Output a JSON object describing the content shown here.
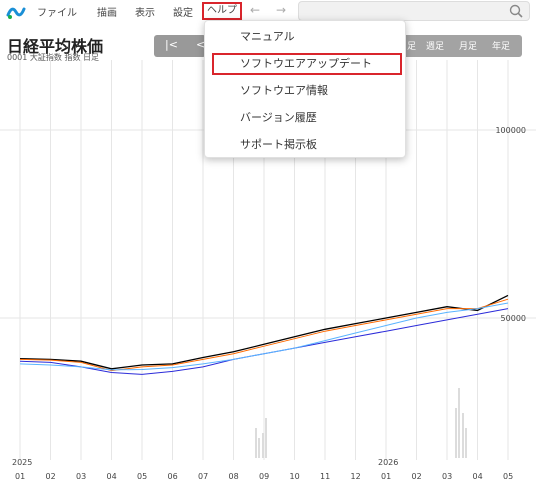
{
  "menu": {
    "items": [
      "ファイル",
      "描画",
      "表示",
      "設定"
    ],
    "help_label": "ヘルプ"
  },
  "header": {
    "title": "日経平均株価",
    "subtitle": "0001 大証指数 指数 日足"
  },
  "chart_controls": {
    "first": "|<",
    "prev": "<"
  },
  "periods": [
    "足",
    "週足",
    "月足",
    "年足"
  ],
  "help_menu": {
    "items": [
      "マニュアル",
      "ソフトウエアアップデート",
      "ソフトウエア情報",
      "バージョン履歴",
      "サポート掲示板"
    ],
    "highlighted": "ソフトウエアアップデート"
  },
  "colors": {
    "highlight": "#d9252c",
    "candles": "#000000",
    "ma_short": "#ff6a00",
    "ma_mid": "#d9252c",
    "ma_long": "#2b2bd9",
    "ma_xlong": "#5ab4ff",
    "lagging_span": "#2a8f1a"
  },
  "chart_data": {
    "type": "line",
    "y_ticks": [
      "100000",
      "50000"
    ],
    "ylim": [
      25000,
      110000
    ],
    "x_ticks": [
      "01",
      "02",
      "03",
      "04",
      "05",
      "06",
      "07",
      "08",
      "09",
      "10",
      "11",
      "12",
      "01",
      "02",
      "03",
      "04",
      "05"
    ],
    "years": [
      "2025",
      "2026"
    ],
    "series": [
      {
        "name": "price",
        "values": [
          39200,
          39000,
          38500,
          36500,
          37500,
          37800,
          39500,
          41000,
          43000,
          45000,
          47000,
          48500,
          50000,
          51500,
          53000,
          52000,
          56000
        ]
      },
      {
        "name": "ma_short",
        "values": [
          39000,
          38800,
          38200,
          36000,
          37000,
          37500,
          39000,
          40500,
          42500,
          44500,
          46500,
          48000,
          49500,
          51000,
          52500,
          52500,
          55000
        ]
      },
      {
        "name": "ma_long",
        "values": [
          38500,
          38200,
          37000,
          35500,
          35000,
          35800,
          37000,
          39000,
          40500,
          42000,
          43500,
          45000,
          46500,
          48000,
          49500,
          51000,
          52500
        ]
      },
      {
        "name": "ma_xlong",
        "values": [
          37800,
          37500,
          37000,
          36200,
          36300,
          36800,
          37800,
          39000,
          40500,
          42000,
          44000,
          46000,
          48000,
          50000,
          51500,
          52500,
          54000
        ]
      }
    ]
  }
}
